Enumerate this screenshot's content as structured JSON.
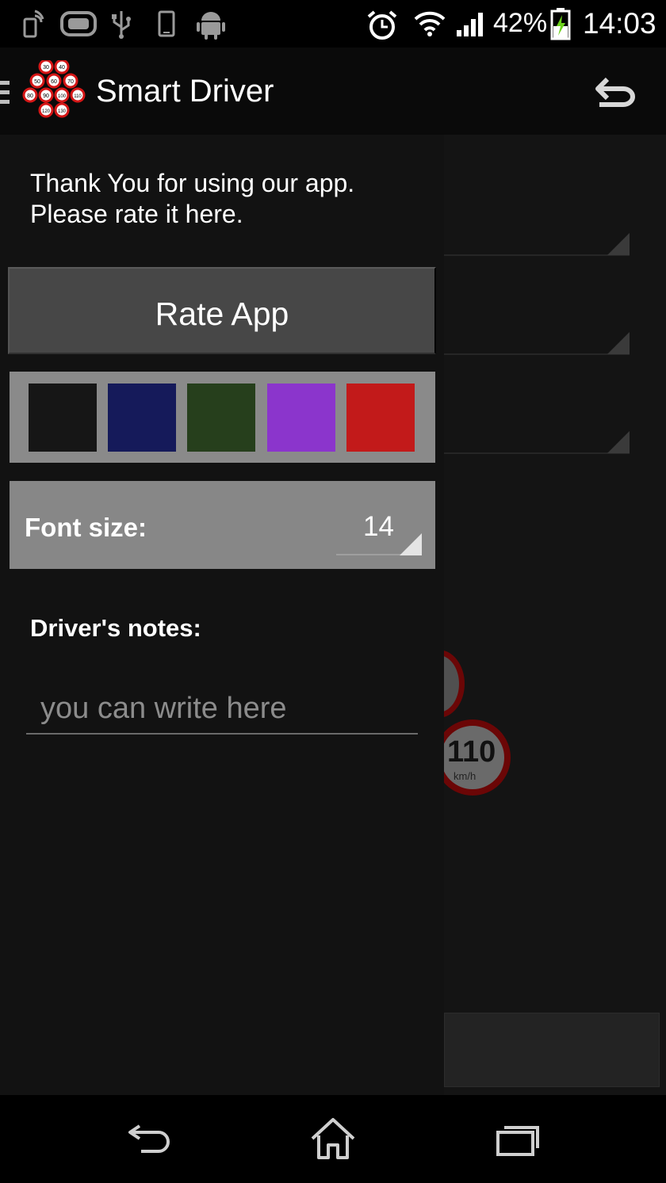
{
  "status_bar": {
    "battery_percent": "42%",
    "time": "14:03",
    "icons": [
      "phone-signal-icon",
      "gameloft-icon",
      "usb-icon",
      "phone-icon",
      "android-icon",
      "alarm-icon",
      "wifi-icon",
      "cell-signal-icon",
      "battery-charging-icon"
    ]
  },
  "action_bar": {
    "title": "Smart Driver",
    "logo_speeds": [
      "30",
      "40",
      "50",
      "60",
      "70",
      "80",
      "90",
      "100",
      "110",
      "120",
      "130"
    ],
    "back_icon": "return-arrow-icon"
  },
  "drawer": {
    "thanks_line1": "Thank You for using our app.",
    "thanks_line2": "Please rate it here.",
    "rate_button": "Rate App",
    "colors": [
      "#161616",
      "#151a5a",
      "#263f1c",
      "#8b35cc",
      "#c21a1a"
    ],
    "font_size_label": "Font size:",
    "font_size_value": "14",
    "notes_label": "Driver's notes:",
    "notes_placeholder": "you can write here"
  },
  "background": {
    "speed_sign_value": "110",
    "speed_sign_unit": "km/h"
  },
  "nav_bar": {
    "icons": [
      "back-icon",
      "home-icon",
      "recent-apps-icon"
    ]
  }
}
